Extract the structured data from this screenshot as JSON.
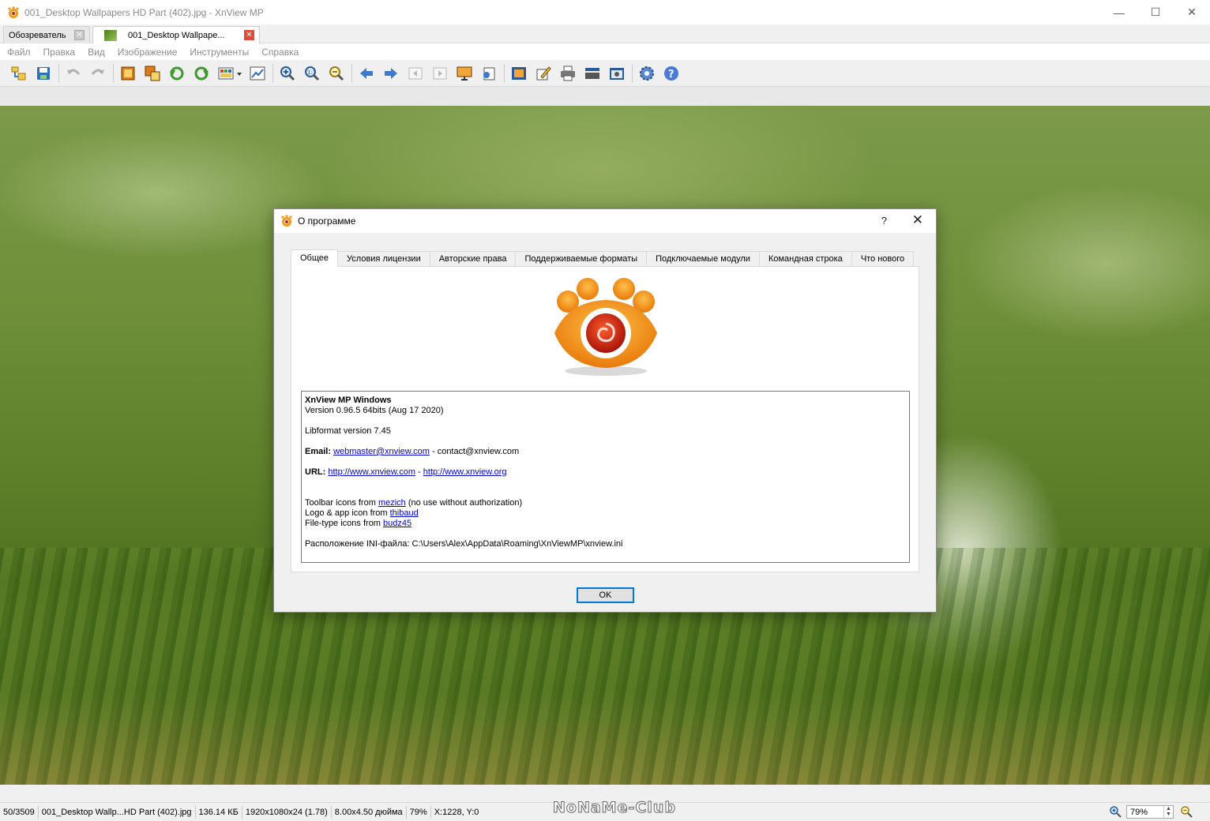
{
  "window": {
    "title": "001_Desktop Wallpapers  HD Part (402).jpg - XnView MP",
    "controls": {
      "minimize": "—",
      "maximize": "☐",
      "close": "✕"
    }
  },
  "tabs": [
    {
      "label": "Обозреватель",
      "close": "✕"
    },
    {
      "label": "001_Desktop Wallpape...",
      "close": "✕"
    }
  ],
  "menu": [
    "Файл",
    "Правка",
    "Вид",
    "Изображение",
    "Инструменты",
    "Справка"
  ],
  "toolbar_icons": [
    "browse-icon",
    "save-icon",
    "undo-icon",
    "redo-icon",
    "crop-icon",
    "resize-icon",
    "rotate-left-icon",
    "rotate-right-icon",
    "color-adjust-icon",
    "levels-icon",
    "zoom-in-icon",
    "zoom-fit-icon",
    "zoom-out-icon",
    "previous-icon",
    "next-icon",
    "first-icon",
    "last-icon",
    "slideshow-icon",
    "info-icon",
    "fullscreen-icon",
    "edit-icon",
    "print-icon",
    "scan-icon",
    "capture-icon",
    "settings-icon",
    "help-icon"
  ],
  "status": {
    "index": "50/3509",
    "filename": "001_Desktop Wallp...HD Part (402).jpg",
    "size": "136.14 КБ",
    "dimensions": "1920x1080x24 (1.78)",
    "print_size": "8.00x4.50 дюйма",
    "zoom": "79%",
    "coords": "X:1228, Y:0",
    "zoom_field": "79%"
  },
  "watermark": "NoNaMe-Club",
  "dialog": {
    "title": "О программе",
    "help": "?",
    "close": "✕",
    "tabs": [
      "Общее",
      "Условия лицензии",
      "Авторские права",
      "Поддерживаемые форматы",
      "Подключаемые модули",
      "Командная строка",
      "Что нового"
    ],
    "info": {
      "product": "XnView MP Windows",
      "version": "Version 0.96.5 64bits (Aug 17 2020)",
      "libformat": "Libformat version 7.45",
      "email_label": "Email",
      "email_link": "webmaster@xnview.com",
      "email_rest": " - contact@xnview.com",
      "url_label": "URL",
      "url_link1": "http://www.xnview.com",
      "url_sep": " - ",
      "url_link2": "http://www.xnview.org",
      "toolbar_credit_pre": "Toolbar icons from ",
      "toolbar_credit_link": "mezich",
      "toolbar_credit_post": " (no use without authorization)",
      "logo_credit_pre": "Logo & app icon from ",
      "logo_credit_link": "thibaud",
      "filetype_credit_pre": "File-type icons from ",
      "filetype_credit_link": "budz45",
      "ini_path": "Расположение INI-файла: C:\\Users\\Alex\\AppData\\Roaming\\XnViewMP\\xnview.ini"
    },
    "ok": "OK"
  },
  "colors": {
    "accent": "#0078d7",
    "link": "#0000d0",
    "logo_orange": "#f39a1a",
    "logo_red": "#c8200c"
  }
}
